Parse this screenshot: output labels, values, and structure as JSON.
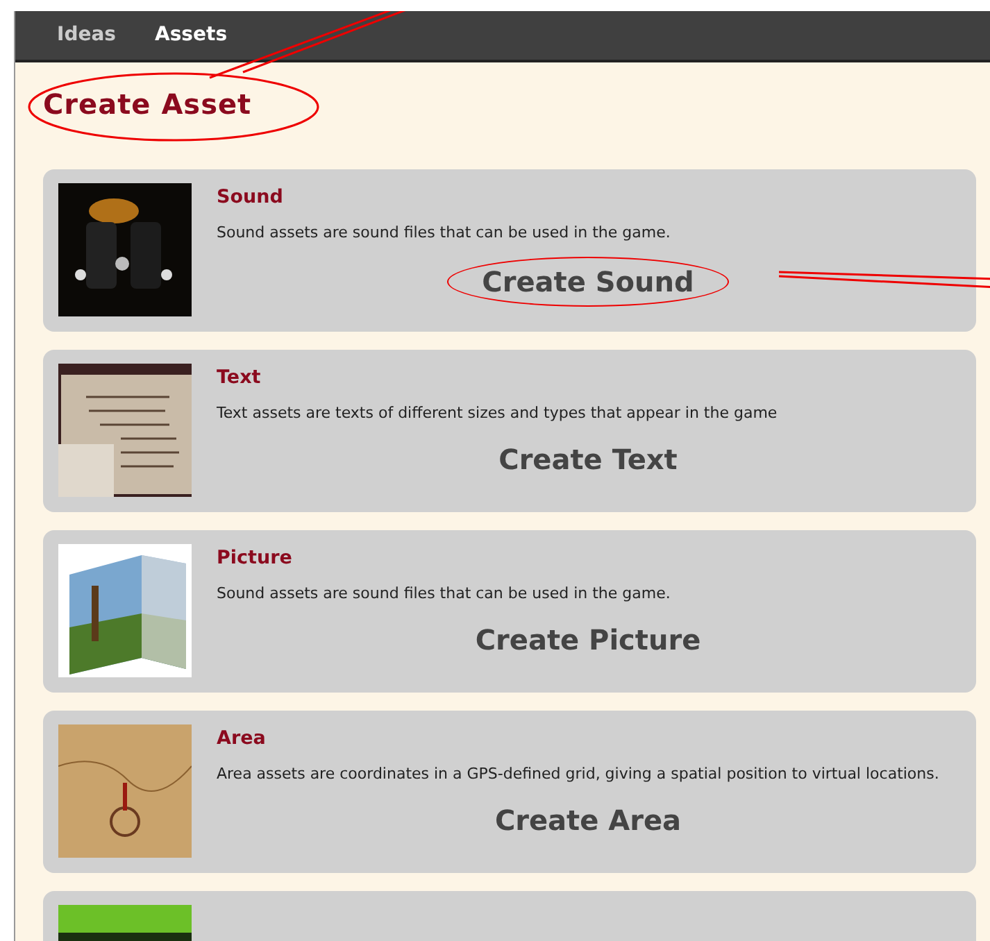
{
  "nav": [
    {
      "label": "Ideas",
      "selected": false
    },
    {
      "label": "Assets",
      "selected": true
    }
  ],
  "title": "Create Asset",
  "assets": [
    {
      "name": "Sound",
      "description": "Sound assets are sound files that can be used in the game.",
      "action": "Create Sound",
      "kind": "speakers",
      "highlighted": true
    },
    {
      "name": "Text",
      "description": "Text assets are texts of different sizes and types that appear in the game",
      "action": "Create Text",
      "kind": "letter",
      "highlighted": false
    },
    {
      "name": "Picture",
      "description": "Sound assets are sound files that can be used in the game.",
      "action": "Create Picture",
      "kind": "photo",
      "highlighted": false
    },
    {
      "name": "Area",
      "description": "Area assets are coordinates in a GPS-defined grid, giving a spatial position to virtual locations.",
      "action": "Create Area",
      "kind": "map",
      "highlighted": false
    },
    {
      "kind": "landscape"
    }
  ]
}
